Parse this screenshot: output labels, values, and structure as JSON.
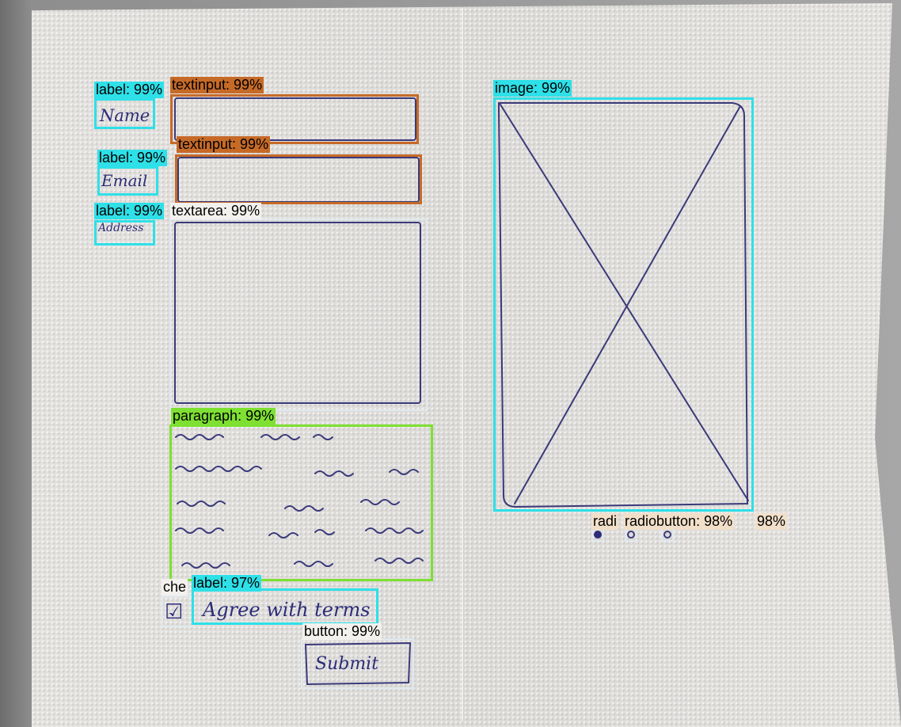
{
  "sketch": {
    "name_label": "Name",
    "email_label": "Email",
    "address_label": "Address",
    "agree_label": "Agree with terms",
    "submit_label": "Submit",
    "checkbox_mark": "☑"
  },
  "detections": {
    "label_name": "label: 99%",
    "textinput_name": "textinput: 99%",
    "label_email": "label: 99%",
    "textinput_email": "textinput: 99%",
    "label_address": "label: 99%",
    "textarea": "textarea: 99%",
    "paragraph": "paragraph: 99%",
    "image": "image: 99%",
    "radio_1": "radi",
    "radio_2": "radiobutton: 98%",
    "radio_3": "98%",
    "checkbox": "che",
    "label_agree": "label: 97%",
    "button": "button: 99%"
  },
  "colors": {
    "label": "#2ee0e8",
    "textinput": "#c66a28",
    "paragraph": "#7ee032",
    "ink": "#2c2c78"
  }
}
